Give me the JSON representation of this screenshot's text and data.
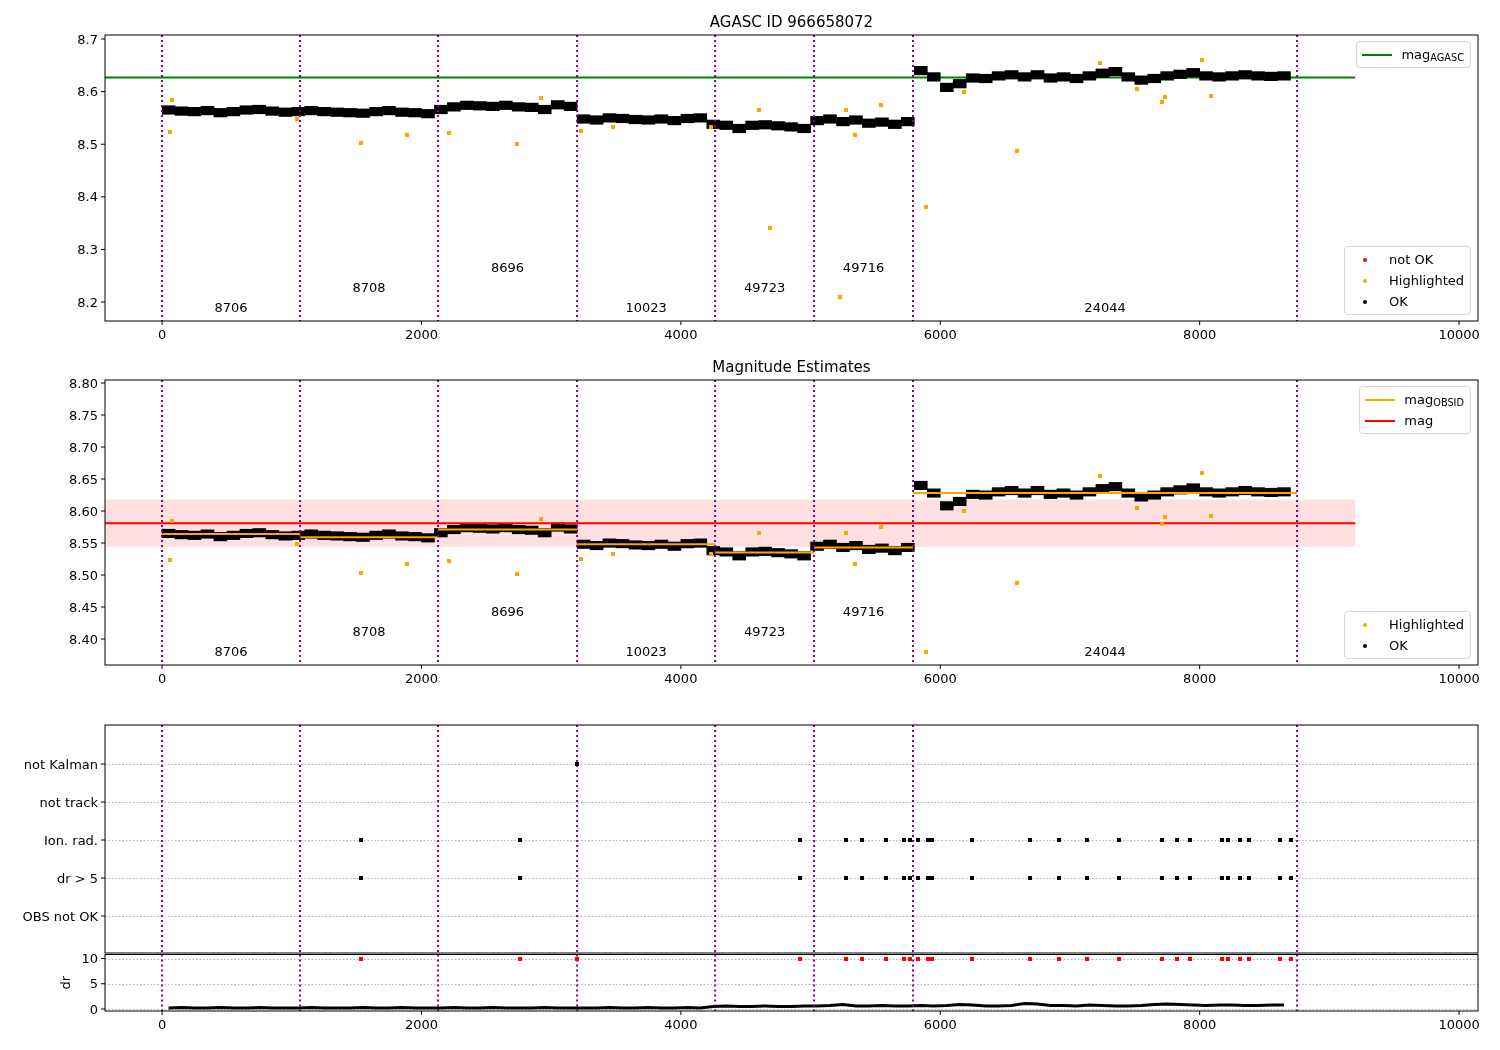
{
  "charts": [
    {
      "title": "AGASC ID 966658072",
      "legends": [
        {
          "entries": [
            {
              "label": "mag$_{AGASC}$",
              "color": "#008000",
              "kind": "line"
            }
          ]
        },
        {
          "entries": [
            {
              "label": "not OK",
              "color": "#ff0000",
              "kind": "dot"
            },
            {
              "label": "Highlighted",
              "color": "#ffa500",
              "kind": "dot"
            },
            {
              "label": "OK",
              "color": "#000000",
              "kind": "dot"
            }
          ]
        }
      ],
      "chart_data": {
        "type": "scatter",
        "xlim": [
          -440,
          10146
        ],
        "ylim": [
          8.164,
          8.7076
        ],
        "xticks": [
          0,
          2000,
          4000,
          6000,
          8000,
          10000
        ],
        "yticks": [
          8.2,
          8.3,
          8.4,
          8.5,
          8.6,
          8.7
        ],
        "series": [
          {
            "type": "line",
            "color": "#008000",
            "x": [
              -440,
              9200
            ],
            "values": [
              8.627,
              8.627
            ]
          },
          {
            "type": "scatter",
            "color": "#000000",
            "x": [
              50,
              150,
              250,
              350,
              450,
              550,
              650,
              750,
              850,
              950,
              1050,
              1150,
              1250,
              1350,
              1450,
              1550,
              1650,
              1750,
              1850,
              1950,
              2050,
              2150,
              2250,
              2350,
              2450,
              2550,
              2650,
              2750,
              2850,
              2950,
              3050,
              3150,
              3250,
              3350,
              3450,
              3550,
              3650,
              3750,
              3850,
              3950,
              4050,
              4150,
              4250,
              4350,
              4450,
              4550,
              4650,
              4750,
              4850,
              4950,
              5050,
              5150,
              5250,
              5350,
              5450,
              5550,
              5650,
              5750,
              5850,
              5950,
              6050,
              6150,
              6250,
              6350,
              6450,
              6550,
              6650,
              6750,
              6850,
              6950,
              7050,
              7150,
              7250,
              7350,
              7450,
              7550,
              7650,
              7750,
              7850,
              7950,
              8050,
              8150,
              8250,
              8350,
              8450,
              8550,
              8650
            ],
            "values": [
              8.565,
              8.563,
              8.562,
              8.564,
              8.56,
              8.562,
              8.565,
              8.566,
              8.563,
              8.561,
              8.562,
              8.564,
              8.562,
              8.561,
              8.56,
              8.559,
              8.562,
              8.564,
              8.561,
              8.56,
              8.558,
              8.566,
              8.571,
              8.574,
              8.573,
              8.572,
              8.574,
              8.571,
              8.57,
              8.566,
              8.575,
              8.572,
              8.548,
              8.546,
              8.55,
              8.549,
              8.547,
              8.546,
              8.548,
              8.545,
              8.549,
              8.55,
              8.538,
              8.536,
              8.53,
              8.536,
              8.537,
              8.535,
              8.533,
              8.53,
              8.545,
              8.548,
              8.543,
              8.546,
              8.54,
              8.542,
              8.538,
              8.543,
              8.64,
              8.628,
              8.608,
              8.615,
              8.626,
              8.625,
              8.63,
              8.632,
              8.628,
              8.632,
              8.626,
              8.628,
              8.625,
              8.63,
              8.635,
              8.638,
              8.628,
              8.622,
              8.625,
              8.63,
              8.633,
              8.636,
              8.63,
              8.628,
              8.63,
              8.632,
              8.63,
              8.629,
              8.63
            ]
          },
          {
            "type": "scatter",
            "color": "#ffa500",
            "x": [
              60,
              80,
              1040,
              1530,
              1890,
              2210,
              2740,
              2920,
              3230,
              3480,
              4230,
              4600,
              4690,
              5230,
              5270,
              5340,
              5540,
              5890,
              6180,
              6590,
              7230,
              7520,
              7710,
              7730,
              8020,
              8090
            ],
            "values": [
              8.523,
              8.585,
              8.548,
              8.503,
              8.517,
              8.522,
              8.501,
              8.588,
              8.525,
              8.533,
              8.533,
              8.565,
              8.34,
              8.21,
              8.565,
              8.517,
              8.575,
              8.38,
              8.6,
              8.488,
              8.655,
              8.605,
              8.58,
              8.59,
              8.66,
              8.592
            ]
          }
        ],
        "ref_lines": [
          {
            "axis": "x",
            "value": 0
          },
          {
            "axis": "x",
            "value": 1064
          },
          {
            "axis": "x",
            "value": 2128
          },
          {
            "axis": "x",
            "value": 3200
          },
          {
            "axis": "x",
            "value": 4264
          },
          {
            "axis": "x",
            "value": 5027
          },
          {
            "axis": "x",
            "value": 5790
          },
          {
            "axis": "x",
            "value": 8751
          }
        ],
        "annotations": [
          "8706",
          "8708",
          "8696",
          "10023",
          "49723",
          "49716",
          "24044"
        ]
      }
    },
    {
      "title": "Magnitude Estimates",
      "legends": [
        {
          "entries": [
            {
              "label": "mag$_{OBSID}$",
              "color": "#ffa500",
              "kind": "line"
            },
            {
              "label": "mag",
              "color": "#ff0000",
              "kind": "line"
            }
          ]
        },
        {
          "entries": [
            {
              "label": "Highlighted",
              "color": "#ffa500",
              "kind": "dot"
            },
            {
              "label": "OK",
              "color": "#000000",
              "kind": "dot"
            }
          ]
        }
      ],
      "chart_data": {
        "type": "scatter",
        "xlim": [
          -440,
          10146
        ],
        "ylim": [
          8.3594,
          8.8047
        ],
        "xticks": [
          0,
          2000,
          4000,
          6000,
          8000,
          10000
        ],
        "yticks": [
          {
            "value": 8.4,
            "label": "8.40"
          },
          {
            "value": 8.45,
            "label": "8.45"
          },
          {
            "value": 8.5,
            "label": "8.50"
          },
          {
            "value": 8.55,
            "label": "8.55"
          },
          {
            "value": 8.6,
            "label": "8.60"
          },
          {
            "value": 8.65,
            "label": "8.65"
          },
          {
            "value": 8.7,
            "label": "8.70"
          },
          {
            "value": 8.75,
            "label": "8.75"
          },
          {
            "value": 8.8,
            "label": "8.80"
          }
        ],
        "series": [
          {
            "type": "scatter",
            "color": "#000000",
            "x": [
              50,
              150,
              250,
              350,
              450,
              550,
              650,
              750,
              850,
              950,
              1050,
              1150,
              1250,
              1350,
              1450,
              1550,
              1650,
              1750,
              1850,
              1950,
              2050,
              2150,
              2250,
              2350,
              2450,
              2550,
              2650,
              2750,
              2850,
              2950,
              3050,
              3150,
              3250,
              3350,
              3450,
              3550,
              3650,
              3750,
              3850,
              3950,
              4050,
              4150,
              4250,
              4350,
              4450,
              4550,
              4650,
              4750,
              4850,
              4950,
              5050,
              5150,
              5250,
              5350,
              5450,
              5550,
              5650,
              5750,
              5850,
              5950,
              6050,
              6150,
              6250,
              6350,
              6450,
              6550,
              6650,
              6750,
              6850,
              6950,
              7050,
              7150,
              7250,
              7350,
              7450,
              7550,
              7650,
              7750,
              7850,
              7950,
              8050,
              8150,
              8250,
              8350,
              8450,
              8550,
              8650
            ],
            "values": [
              8.565,
              8.563,
              8.562,
              8.564,
              8.56,
              8.562,
              8.565,
              8.566,
              8.563,
              8.561,
              8.562,
              8.564,
              8.562,
              8.561,
              8.56,
              8.559,
              8.562,
              8.564,
              8.561,
              8.56,
              8.558,
              8.566,
              8.571,
              8.574,
              8.573,
              8.572,
              8.574,
              8.571,
              8.57,
              8.566,
              8.575,
              8.572,
              8.548,
              8.546,
              8.55,
              8.549,
              8.547,
              8.546,
              8.548,
              8.545,
              8.549,
              8.55,
              8.538,
              8.536,
              8.53,
              8.536,
              8.537,
              8.535,
              8.533,
              8.53,
              8.545,
              8.548,
              8.543,
              8.546,
              8.54,
              8.542,
              8.538,
              8.543,
              8.64,
              8.628,
              8.608,
              8.615,
              8.626,
              8.625,
              8.63,
              8.632,
              8.628,
              8.632,
              8.626,
              8.628,
              8.625,
              8.63,
              8.635,
              8.638,
              8.628,
              8.622,
              8.625,
              8.63,
              8.633,
              8.636,
              8.63,
              8.628,
              8.63,
              8.632,
              8.63,
              8.629,
              8.63
            ]
          },
          {
            "type": "line",
            "color": "#ffa500",
            "x": [
              0,
              1064
            ],
            "values": [
              8.564,
              8.564
            ]
          },
          {
            "type": "line",
            "color": "#ffa500",
            "x": [
              1064,
              2128
            ],
            "values": [
              8.559,
              8.559
            ]
          },
          {
            "type": "line",
            "color": "#ffa500",
            "x": [
              2128,
              3200
            ],
            "values": [
              8.571,
              8.571
            ]
          },
          {
            "type": "line",
            "color": "#ffa500",
            "x": [
              3200,
              4264
            ],
            "values": [
              8.548,
              8.548
            ]
          },
          {
            "type": "line",
            "color": "#ffa500",
            "x": [
              4264,
              5027
            ],
            "values": [
              8.535,
              8.535
            ]
          },
          {
            "type": "line",
            "color": "#ffa500",
            "x": [
              5027,
              5790
            ],
            "values": [
              8.543,
              8.543
            ]
          },
          {
            "type": "line",
            "color": "#ffa500",
            "x": [
              5790,
              8751
            ],
            "values": [
              8.628,
              8.628
            ]
          },
          {
            "type": "scatter",
            "color": "#ffa500",
            "x": [
              60,
              80,
              1040,
              1530,
              1890,
              2210,
              2740,
              2920,
              3230,
              3480,
              4230,
              4600,
              5270,
              5340,
              5540,
              5890,
              6180,
              6590,
              7230,
              7520,
              7710,
              7730,
              8020,
              8090
            ],
            "values": [
              8.523,
              8.585,
              8.548,
              8.503,
              8.517,
              8.522,
              8.501,
              8.588,
              8.525,
              8.533,
              8.533,
              8.565,
              8.565,
              8.517,
              8.575,
              8.38,
              8.6,
              8.488,
              8.655,
              8.605,
              8.58,
              8.59,
              8.66,
              8.592
            ]
          },
          {
            "type": "line",
            "color": "#ff0000",
            "x": [
              -440,
              9200
            ],
            "values": [
              8.581,
              8.581
            ]
          }
        ],
        "bands": [
          {
            "axis": "y",
            "from": 8.544,
            "to": 8.618,
            "color": "#ffe0e0"
          }
        ],
        "ref_lines": [
          {
            "axis": "x",
            "value": 0
          },
          {
            "axis": "x",
            "value": 1064
          },
          {
            "axis": "x",
            "value": 2128
          },
          {
            "axis": "x",
            "value": 3200
          },
          {
            "axis": "x",
            "value": 4264
          },
          {
            "axis": "x",
            "value": 5027
          },
          {
            "axis": "x",
            "value": 5790
          },
          {
            "axis": "x",
            "value": 8751
          }
        ],
        "annotations": [
          "8706",
          "8708",
          "8696",
          "10023",
          "49723",
          "49716",
          "24044"
        ]
      }
    },
    {
      "grid": true,
      "chart_data": {
        "type": "scatter",
        "orientation": "horizontal",
        "xlim": [
          -440,
          10146
        ],
        "categories": [
          "not Kalman",
          "not track",
          "Ion. rad.",
          "dr > 5",
          "OBS not OK"
        ],
        "series": [
          {
            "type": "scatter",
            "color": "#000000",
            "values": [
              null,
              null,
              1534,
              1534,
              null
            ]
          },
          {
            "type": "scatter",
            "color": "#000000",
            "values": [
              null,
              null,
              2760,
              2760,
              null
            ]
          },
          {
            "type": "scatter",
            "color": "#000000",
            "values": [
              3200,
              null,
              null,
              null,
              null
            ]
          },
          {
            "type": "scatter",
            "color": "#000000",
            "values": [
              null,
              null,
              4919,
              4919,
              null
            ]
          },
          {
            "type": "scatter",
            "color": "#000000",
            "values": [
              null,
              null,
              5274,
              5274,
              null
            ]
          },
          {
            "type": "scatter",
            "color": "#000000",
            "values": [
              null,
              null,
              5397,
              5397,
              null
            ]
          },
          {
            "type": "scatter",
            "color": "#000000",
            "values": [
              null,
              null,
              5582,
              5582,
              null
            ]
          },
          {
            "type": "scatter",
            "color": "#000000",
            "values": [
              null,
              null,
              5721,
              5721,
              null
            ]
          },
          {
            "type": "scatter",
            "color": "#000000",
            "values": [
              null,
              null,
              5767,
              5767,
              null
            ]
          },
          {
            "type": "scatter",
            "color": "#000000",
            "values": [
              null,
              null,
              5829,
              5829,
              null
            ]
          },
          {
            "type": "scatter",
            "color": "#000000",
            "values": [
              null,
              null,
              5906,
              5906,
              null
            ]
          },
          {
            "type": "scatter",
            "color": "#000000",
            "values": [
              null,
              null,
              5937,
              5937,
              null
            ]
          },
          {
            "type": "scatter",
            "color": "#000000",
            "values": [
              null,
              null,
              6245,
              6245,
              null
            ]
          },
          {
            "type": "scatter",
            "color": "#000000",
            "values": [
              null,
              null,
              6692,
              6692,
              null
            ]
          },
          {
            "type": "scatter",
            "color": "#000000",
            "values": [
              null,
              null,
              6916,
              6916,
              null
            ]
          },
          {
            "type": "scatter",
            "color": "#000000",
            "values": [
              null,
              null,
              7132,
              7132,
              null
            ]
          },
          {
            "type": "scatter",
            "color": "#000000",
            "values": [
              null,
              null,
              7379,
              7379,
              null
            ]
          },
          {
            "type": "scatter",
            "color": "#000000",
            "values": [
              null,
              null,
              7710,
              7710,
              null
            ]
          },
          {
            "type": "scatter",
            "color": "#000000",
            "values": [
              null,
              null,
              7822,
              7822,
              null
            ]
          },
          {
            "type": "scatter",
            "color": "#000000",
            "values": [
              null,
              null,
              7926,
              7926,
              null
            ]
          },
          {
            "type": "scatter",
            "color": "#000000",
            "values": [
              null,
              null,
              8173,
              8173,
              null
            ]
          },
          {
            "type": "scatter",
            "color": "#000000",
            "values": [
              null,
              null,
              8219,
              8219,
              null
            ]
          },
          {
            "type": "scatter",
            "color": "#000000",
            "values": [
              null,
              null,
              8312,
              8312,
              null
            ]
          },
          {
            "type": "scatter",
            "color": "#000000",
            "values": [
              null,
              null,
              8381,
              8381,
              null
            ]
          },
          {
            "type": "scatter",
            "color": "#000000",
            "values": [
              null,
              null,
              8620,
              8620,
              null
            ]
          },
          {
            "type": "scatter",
            "color": "#000000",
            "values": [
              null,
              null,
              8705,
              8705,
              null
            ]
          }
        ],
        "ref_lines": [
          {
            "axis": "x",
            "value": 0
          },
          {
            "axis": "x",
            "value": 1064
          },
          {
            "axis": "x",
            "value": 2128
          },
          {
            "axis": "x",
            "value": 3200
          },
          {
            "axis": "x",
            "value": 4264
          },
          {
            "axis": "x",
            "value": 5027
          },
          {
            "axis": "x",
            "value": 5790
          },
          {
            "axis": "x",
            "value": 8751
          }
        ]
      }
    },
    {
      "grid": true,
      "chart_data": {
        "type": "scatter",
        "ylabel": "dr",
        "xlim": [
          -440,
          10146
        ],
        "ylim": [
          -0.4,
          10.8
        ],
        "xticks": [
          0,
          2000,
          4000,
          6000,
          8000,
          10000
        ],
        "yticks": [
          0,
          5,
          10
        ],
        "series": [
          {
            "type": "line",
            "color": "#000000",
            "x": [
              50,
              150,
              250,
              350,
              450,
              550,
              650,
              750,
              850,
              950,
              1050,
              1150,
              1250,
              1350,
              1450,
              1550,
              1650,
              1750,
              1850,
              1950,
              2050,
              2150,
              2250,
              2350,
              2450,
              2550,
              2650,
              2750,
              2850,
              2950,
              3050,
              3150,
              3250,
              3350,
              3450,
              3550,
              3650,
              3750,
              3850,
              3950,
              4050,
              4150,
              4250,
              4350,
              4450,
              4550,
              4650,
              4750,
              4850,
              4950,
              5050,
              5150,
              5250,
              5350,
              5450,
              5550,
              5650,
              5750,
              5850,
              5950,
              6050,
              6150,
              6250,
              6350,
              6450,
              6550,
              6650,
              6750,
              6850,
              6950,
              7050,
              7150,
              7250,
              7350,
              7450,
              7550,
              7650,
              7750,
              7850,
              7950,
              8050,
              8150,
              8250,
              8350,
              8450,
              8550,
              8650
            ],
            "values": [
              0.2,
              0.3,
              0.2,
              0.2,
              0.3,
              0.2,
              0.2,
              0.3,
              0.2,
              0.2,
              0.2,
              0.3,
              0.2,
              0.2,
              0.2,
              0.3,
              0.2,
              0.2,
              0.3,
              0.2,
              0.2,
              0.2,
              0.3,
              0.2,
              0.2,
              0.3,
              0.2,
              0.2,
              0.2,
              0.3,
              0.2,
              0.2,
              0.2,
              0.2,
              0.3,
              0.2,
              0.2,
              0.3,
              0.2,
              0.2,
              0.3,
              0.2,
              0.5,
              0.6,
              0.5,
              0.5,
              0.6,
              0.5,
              0.5,
              0.6,
              0.6,
              0.7,
              0.9,
              0.6,
              0.6,
              0.7,
              0.6,
              0.6,
              0.7,
              0.6,
              0.7,
              0.9,
              0.8,
              0.6,
              0.6,
              0.7,
              1.1,
              1.0,
              0.7,
              0.7,
              0.6,
              0.8,
              0.7,
              0.6,
              0.6,
              0.7,
              0.9,
              1.0,
              0.9,
              0.8,
              0.7,
              0.8,
              0.8,
              0.7,
              0.7,
              0.8,
              0.8
            ]
          },
          {
            "type": "scatter",
            "color": "#ff0000",
            "x": [
              1534,
              2760,
              3200,
              4919,
              5274,
              5397,
              5582,
              5721,
              5767,
              5829,
              5906,
              5937,
              6245,
              6692,
              6916,
              7132,
              7379,
              7710,
              7822,
              7926,
              8173,
              8219,
              8312,
              8381,
              8620,
              8705
            ],
            "values": [
              10,
              10,
              10,
              10,
              10,
              10,
              10,
              10,
              10,
              10,
              10,
              10,
              10,
              10,
              10,
              10,
              10,
              10,
              10,
              10,
              10,
              10,
              10,
              10,
              10,
              10
            ]
          }
        ],
        "ref_lines": [
          {
            "axis": "x",
            "value": 0
          },
          {
            "axis": "x",
            "value": 1064
          },
          {
            "axis": "x",
            "value": 2128
          },
          {
            "axis": "x",
            "value": 3200
          },
          {
            "axis": "x",
            "value": 4264
          },
          {
            "axis": "x",
            "value": 5027
          },
          {
            "axis": "x",
            "value": 5790
          },
          {
            "axis": "x",
            "value": 8751
          }
        ]
      }
    }
  ]
}
